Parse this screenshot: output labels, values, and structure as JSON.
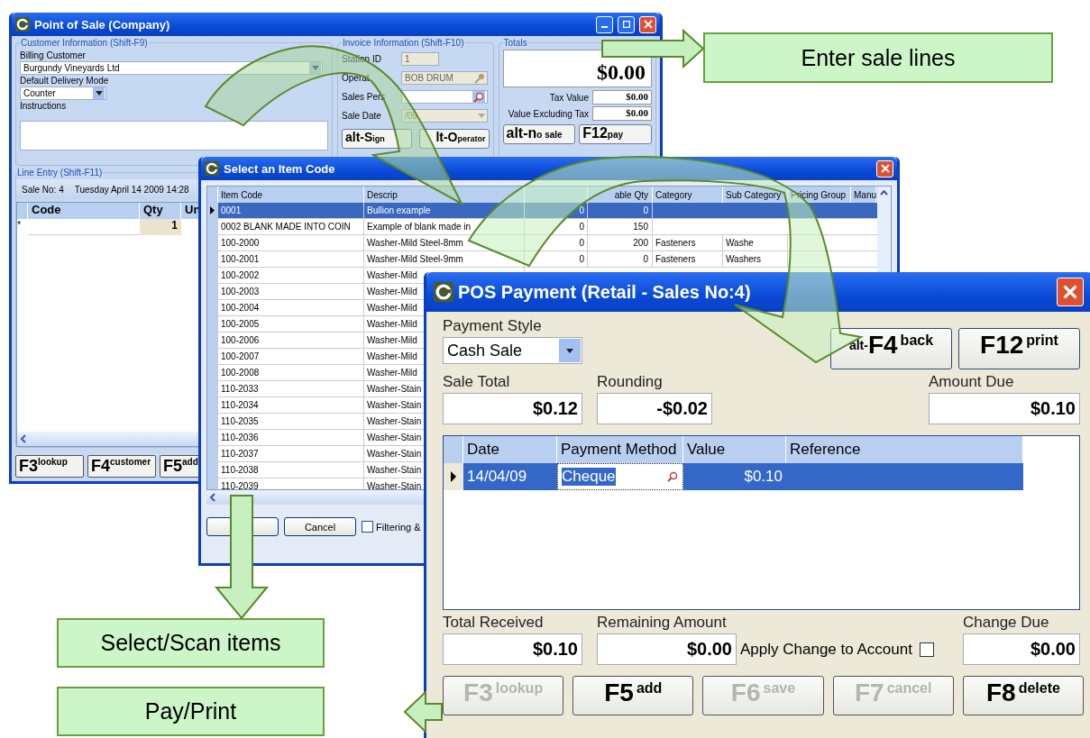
{
  "pos_window": {
    "title": "Point of Sale (Company)",
    "customer_group": {
      "legend": "Customer Information (Shift-F9)",
      "billing_label": "Billing Customer",
      "billing_value": "Burgundy Vineyards Ltd",
      "delivery_label": "Default Delivery Mode",
      "delivery_value": "Counter",
      "instructions_label": "Instructions"
    },
    "invoice_group": {
      "legend": "Invoice Information (Shift-F10)",
      "rows": [
        {
          "label": "Station ID",
          "value": "1",
          "kind": "text"
        },
        {
          "label": "Operat",
          "value": "BOB DRUM",
          "kind": "key"
        },
        {
          "label": "Sales Pers",
          "kind": "search"
        },
        {
          "label": "Sale Date",
          "value": "/09",
          "kind": "combo"
        }
      ],
      "buttons": [
        {
          "key": "alt-S",
          "label": "ign"
        },
        {
          "key": "lt-O",
          "label": "perator"
        }
      ]
    },
    "totals_group": {
      "legend": "Totals",
      "total": "$0.00",
      "rows": [
        {
          "label": "Tax Value",
          "value": "$0.00"
        },
        {
          "label": "Value Excluding Tax",
          "value": "$0.00"
        }
      ],
      "buttons": [
        {
          "key": "alt-n",
          "label": "o sale"
        },
        {
          "key": "F12",
          "label": "pay"
        }
      ]
    },
    "line_entry": {
      "legend": "Line Entry (Shift-F11)",
      "sale_no": "Sale No: 4",
      "date": "Tuesday  April 14  2009  14:28",
      "columns": [
        "Code",
        "Qty",
        "Un"
      ],
      "new_row": {
        "marker": "*",
        "qty": "1"
      }
    },
    "buttons": [
      {
        "key": "F3",
        "label": "lookup"
      },
      {
        "key": "F4",
        "label": "customer"
      },
      {
        "key": "F5",
        "label": "add"
      }
    ]
  },
  "item_window": {
    "title": "Select an Item Code",
    "columns": [
      {
        "label": "Item Code"
      },
      {
        "label": "Descrip"
      },
      {},
      {
        "label": "able Qty"
      },
      {
        "label": "Category"
      },
      {
        "label": "Sub Category"
      },
      {
        "label": "Pricing Group"
      },
      {
        "label": "Manu"
      }
    ],
    "rows": [
      {
        "selected": true,
        "cells": [
          "0001",
          "Bullion example",
          "0",
          "0"
        ]
      },
      {
        "selected": false,
        "cells": [
          "0002 BLANK MADE INTO COIN",
          "Example of blank made in",
          "0",
          "150"
        ]
      },
      {
        "selected": false,
        "cells": [
          "100-2000",
          "Washer-Mild Steel-8mm",
          "0",
          "200",
          "Fasteners",
          "Washe"
        ]
      },
      {
        "selected": false,
        "cells": [
          "100-2001",
          "Washer-Mild Steel-9mm",
          "0",
          "0",
          "Fasteners",
          "Washers"
        ]
      },
      {
        "selected": false,
        "cells": [
          "100-2002",
          "Washer-Mild"
        ]
      },
      {
        "selected": false,
        "cells": [
          "100-2003",
          "Washer-Mild"
        ]
      },
      {
        "selected": false,
        "cells": [
          "100-2004",
          "Washer-Mild"
        ]
      },
      {
        "selected": false,
        "cells": [
          "100-2005",
          "Washer-Mild"
        ]
      },
      {
        "selected": false,
        "cells": [
          "100-2006",
          "Washer-Mild"
        ]
      },
      {
        "selected": false,
        "cells": [
          "100-2007",
          "Washer-Mild"
        ]
      },
      {
        "selected": false,
        "cells": [
          "100-2008",
          "Washer-Mild"
        ]
      },
      {
        "selected": false,
        "cells": [
          "110-2033",
          "Washer-Stain"
        ]
      },
      {
        "selected": false,
        "cells": [
          "110-2034",
          "Washer-Stain"
        ]
      },
      {
        "selected": false,
        "cells": [
          "110-2035",
          "Washer-Stain"
        ]
      },
      {
        "selected": false,
        "cells": [
          "110-2036",
          "Washer-Stain"
        ]
      },
      {
        "selected": false,
        "cells": [
          "110-2037",
          "Washer-Stain"
        ]
      },
      {
        "selected": false,
        "cells": [
          "110-2038",
          "Washer-Stain"
        ]
      },
      {
        "selected": false,
        "cells": [
          "110-2039",
          "Washer-Stain"
        ]
      }
    ],
    "cancel": "Cancel",
    "filter": {
      "label": "Filtering &",
      "checked": false
    }
  },
  "payment_window": {
    "title": "POS Payment (Retail - Sales No:4)",
    "payment_style_label": "Payment Style",
    "payment_style": "Cash Sale",
    "top_buttons": [
      {
        "prefix": "alt-",
        "key": "F4",
        "label": "back"
      },
      {
        "key": "F12",
        "label": "print"
      }
    ],
    "sale_total_label": "Sale Total",
    "sale_total": "$0.12",
    "rounding_label": "Rounding",
    "rounding": "-$0.02",
    "amount_due_label": "Amount Due",
    "amount_due": "$0.10",
    "columns": [
      "Date",
      "Payment Method",
      "Value",
      "Reference"
    ],
    "rows": [
      {
        "selected": true,
        "date": "14/04/09",
        "method": "Cheque",
        "value": "$0.10"
      }
    ],
    "total_received_label": "Total Received",
    "total_received": "$0.10",
    "remaining_label": "Remaining Amount",
    "remaining": "$0.00",
    "apply_change": {
      "label": "Apply Change to Account",
      "checked": false
    },
    "change_due_label": "Change Due",
    "change_due": "$0.00",
    "buttons": [
      {
        "key": "F3",
        "label": "lookup",
        "disabled": true
      },
      {
        "key": "F5",
        "label": "add",
        "disabled": false
      },
      {
        "key": "F6",
        "label": "save",
        "disabled": true
      },
      {
        "key": "F7",
        "label": "cancel",
        "disabled": true
      },
      {
        "key": "F8",
        "label": "delete",
        "disabled": false
      }
    ]
  },
  "callouts": [
    {
      "text": "Enter sale lines",
      "kind": "top"
    },
    {
      "text": "Select/Scan items",
      "kind": "middle"
    },
    {
      "text": "Pay/Print",
      "kind": "bottom"
    }
  ]
}
